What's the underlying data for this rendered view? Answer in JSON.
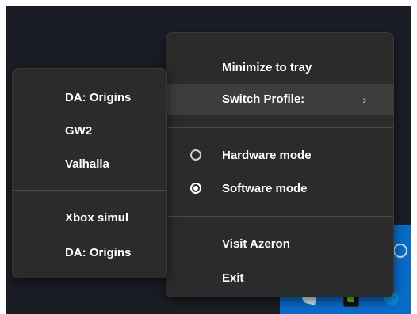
{
  "main_menu": {
    "minimize_label": "Minimize to tray",
    "switch_profile_label": "Switch Profile:",
    "chevron_glyph": "›",
    "hardware_mode_label": "Hardware mode",
    "software_mode_label": "Software mode",
    "selected_mode": "software",
    "visit_label": "Visit Azeron",
    "exit_label": "Exit"
  },
  "profiles_menu": {
    "items": [
      "DA: Origins",
      "GW2",
      "Valhalla",
      "Xbox simul",
      "DA: Origins"
    ]
  },
  "colors": {
    "menu_background": "#2b2b2b",
    "highlight": "#3d3d3d",
    "separator": "#4b4b4b",
    "text": "#ffffff",
    "desktop": "#1a1d24",
    "taskbar": "#0a6cc9"
  }
}
